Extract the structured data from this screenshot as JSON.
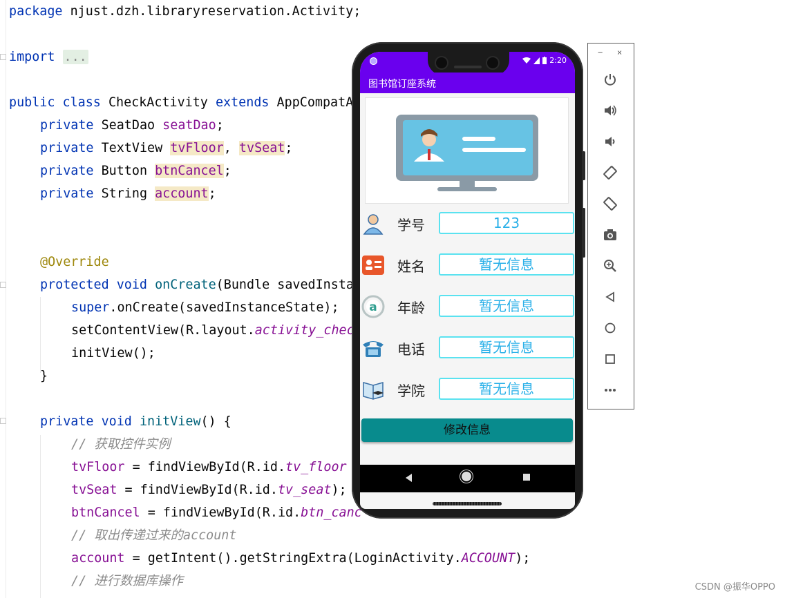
{
  "editor": {
    "lines": {
      "l0_kw": "package",
      "l0_rest": " njust.dzh.libraryreservation.Activity;",
      "l1_kw": "import",
      "l1_fold": "...",
      "l2_kw": "public class",
      "l2_rest": " CheckActivity ",
      "l2_kw2": "extends",
      "l2_rest2": " AppCompatA",
      "l3_kw": "private",
      "l3_type": " SeatDao ",
      "l3_field": "seatDao",
      "l3_end": ";",
      "l4_kw": "private",
      "l4_type": " TextView ",
      "l4_f1": "tvFloor",
      "l4_sep": ", ",
      "l4_f2": "tvSeat",
      "l4_end": ";",
      "l5_kw": "private",
      "l5_type": " Button ",
      "l5_field": "btnCancel",
      "l5_end": ";",
      "l6_kw": "private",
      "l6_type": " String ",
      "l6_field": "account",
      "l6_end": ";",
      "l7_ann": "@Override",
      "l8_kw": "protected void",
      "l8_fn": " onCreate",
      "l8_rest": "(Bundle savedInsta",
      "l9_kw": "super",
      "l9_rest": ".onCreate(savedInstanceState);",
      "l10_a": "setContentView(R.layout.",
      "l10_it": "activity_chec",
      "l11": "initView();",
      "l12": "}",
      "l13_kw": "private void",
      "l13_fn": " initView",
      "l13_rest": "() {",
      "l14_cm": "// 获取控件实例",
      "l15_f": "tvFloor",
      "l15_rest": " = findViewById(R.id.",
      "l15_it": "tv_floor",
      "l16_f": "tvSeat",
      "l16_rest": " = findViewById(R.id.",
      "l16_it": "tv_seat",
      "l16_end": ");",
      "l17_f": "btnCancel",
      "l17_rest": " = findViewById(R.id.",
      "l17_it": "btn_canc",
      "l18_cm": "// 取出传递过来的account",
      "l19_f": "account",
      "l19_rest": " = getIntent().getStringExtra(LoginActivity.",
      "l19_it": "ACCOUNT",
      "l19_end": ");",
      "l20_cm": "// 进行数据库操作"
    }
  },
  "watermark": "CSDN @振华OPPO",
  "phone": {
    "status_time": "2:20",
    "app_title": "图书馆订座系统",
    "rows": [
      {
        "label": "学号",
        "value": "123",
        "icon": "person-icon"
      },
      {
        "label": "姓名",
        "value": "暂无信息",
        "icon": "id-card-icon"
      },
      {
        "label": "年龄",
        "value": "暂无信息",
        "icon": "age-icon"
      },
      {
        "label": "电话",
        "value": "暂无信息",
        "icon": "telephone-icon"
      },
      {
        "label": "学院",
        "value": "暂无信息",
        "icon": "college-icon"
      }
    ],
    "edit_button": "修改信息"
  },
  "toolbar": {
    "minimize": "−",
    "close": "×",
    "buttons": [
      "power-icon",
      "volume-up-icon",
      "volume-down-icon",
      "rotate-left-icon",
      "rotate-right-icon",
      "camera-icon",
      "zoom-icon",
      "back-icon",
      "home-icon",
      "overview-icon",
      "more-icon"
    ]
  },
  "colors": {
    "app_purple": "#6a00ee",
    "button_teal": "#088b8d",
    "field_border": "#5ae2f0",
    "field_text": "#2ab0e8"
  }
}
